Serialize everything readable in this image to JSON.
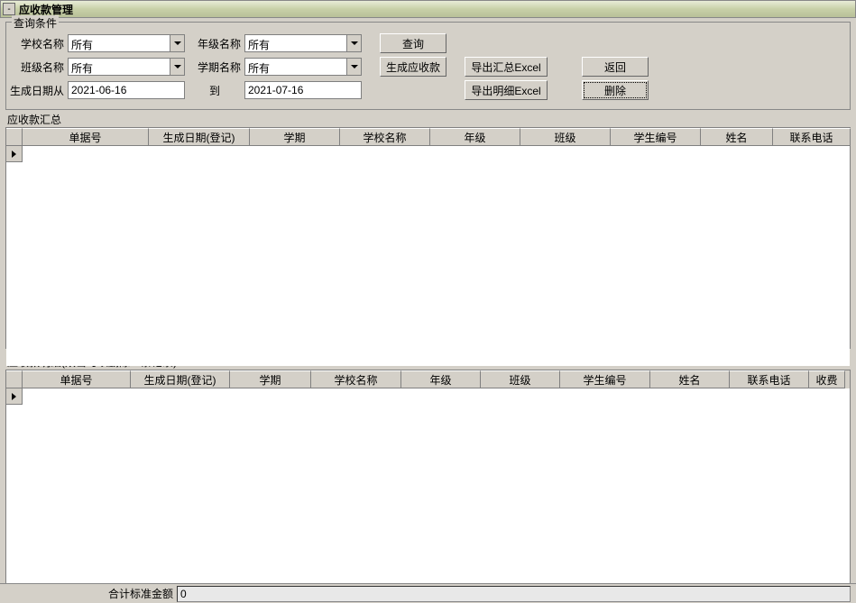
{
  "window": {
    "title": "应收款管理"
  },
  "query": {
    "legend": "查询条件",
    "labels": {
      "school": "学校名称",
      "grade": "年级名称",
      "class": "班级名称",
      "term": "学期名称",
      "dateFrom": "生成日期从",
      "dateTo": "到"
    },
    "values": {
      "school": "所有",
      "grade": "所有",
      "class": "所有",
      "term": "所有",
      "dateFrom": "2021-06-16",
      "dateTo": "2021-07-16"
    },
    "buttons": {
      "search": "查询",
      "generate": "生成应收款",
      "exportSummary": "导出汇总Excel",
      "exportDetail": "导出明细Excel",
      "back": "返回",
      "delete": "删除"
    }
  },
  "summary": {
    "label": "应收款汇总",
    "cols": [
      "单据号",
      "生成日期(登记)",
      "学期",
      "学校名称",
      "年级",
      "班级",
      "学生编号",
      "姓名",
      "联系电话"
    ]
  },
  "detail": {
    "label": "应收款明细(双击可以删除一条记录)",
    "cols": [
      "单据号",
      "生成日期(登记)",
      "学期",
      "学校名称",
      "年级",
      "班级",
      "学生编号",
      "姓名",
      "联系电话",
      "收费"
    ]
  },
  "footer": {
    "label": "合计标准金额",
    "value": "0"
  }
}
